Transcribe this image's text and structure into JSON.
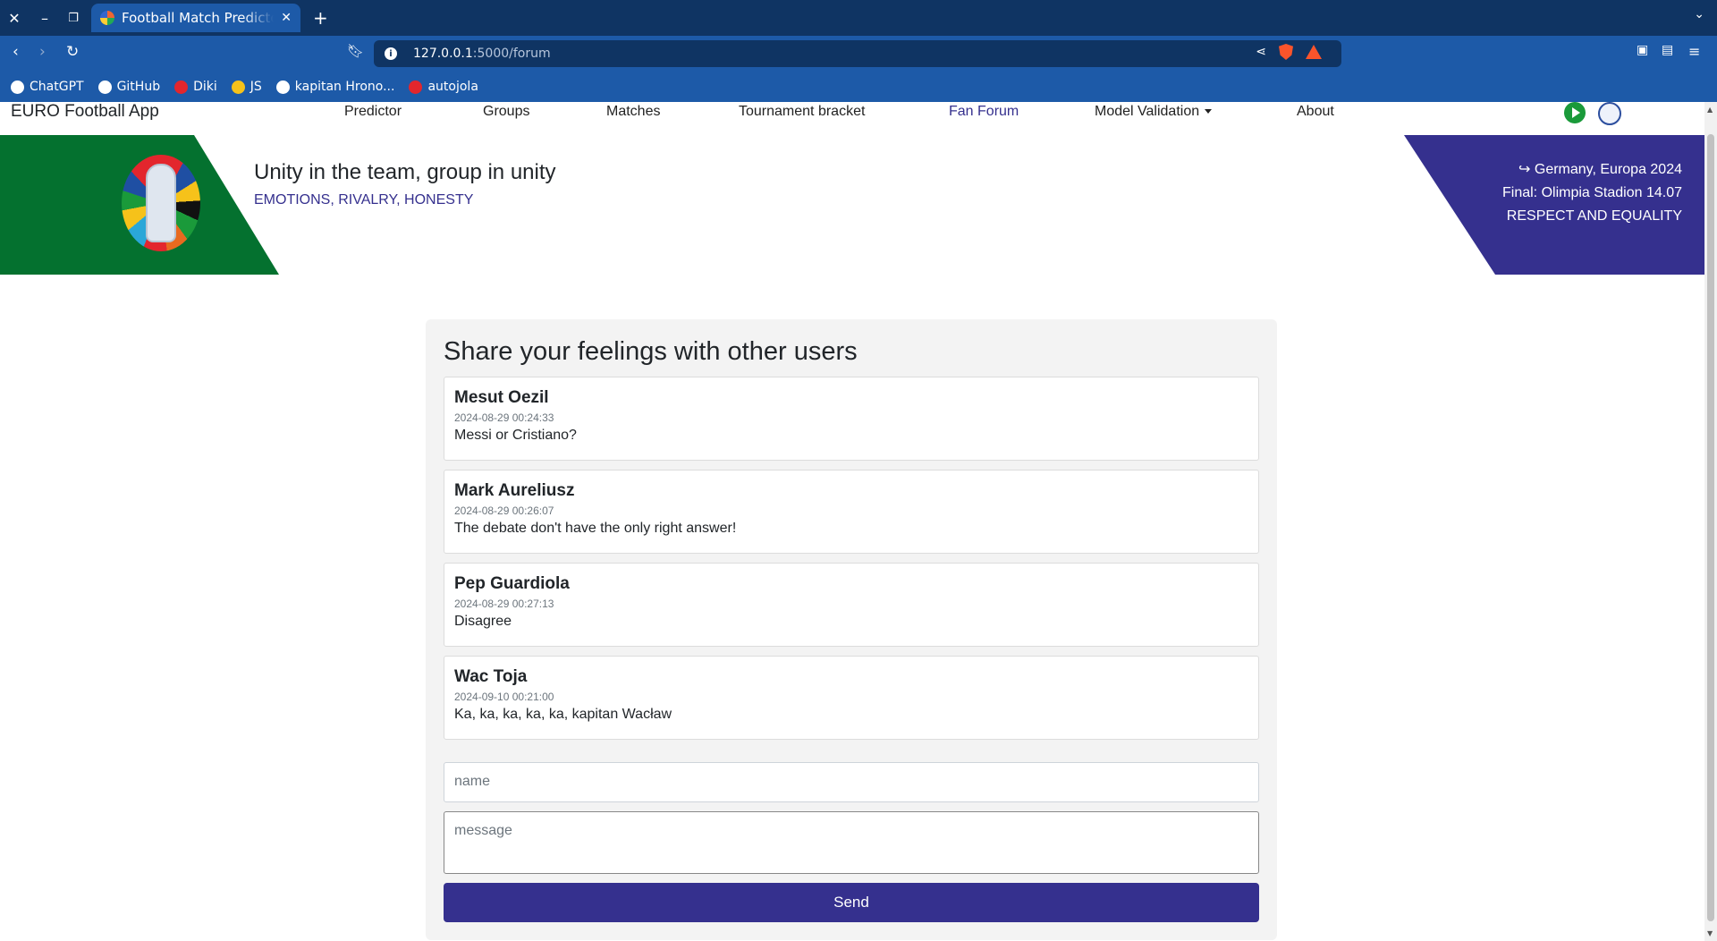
{
  "browser": {
    "tab_title": "Football Match Predictor",
    "url_host": "127.0.0.1",
    "url_path": ":5000/forum",
    "bookmarks": [
      "ChatGPT",
      "GitHub",
      "Diki",
      "JS",
      "kapitan Hrono...",
      "autojola"
    ]
  },
  "nav": {
    "brand": "EURO Football App",
    "links": [
      "Predictor",
      "Groups",
      "Matches",
      "Tournament bracket",
      "Fan Forum",
      "Model Validation",
      "About"
    ],
    "active": "Fan Forum"
  },
  "hero": {
    "title": "Unity in the team, group in unity",
    "subtitle": "EMOTIONS, RIVALRY, HONESTY",
    "right_line1": "↪ Germany, Europa 2024",
    "right_line2": "Final: Olimpia Stadion 14.07",
    "right_line3": "RESPECT AND EQUALITY"
  },
  "forum": {
    "heading": "Share your feelings with other users",
    "posts": [
      {
        "author": "Mesut Oezil",
        "date": "2024-08-29 00:24:33",
        "message": "Messi or Cristiano?"
      },
      {
        "author": "Mark Aureliusz",
        "date": "2024-08-29 00:26:07",
        "message": "The debate don't have the only right answer!"
      },
      {
        "author": "Pep Guardiola",
        "date": "2024-08-29 00:27:13",
        "message": "Disagree"
      },
      {
        "author": "Wac Toja",
        "date": "2024-09-10 00:21:00",
        "message": "Ka, ka, ka, ka, ka, kapitan Wacław"
      }
    ],
    "name_placeholder": "name",
    "message_placeholder": "message",
    "send_label": "Send"
  },
  "colors": {
    "browser_dark": "#0f3463",
    "browser_blue": "#1d5aa8",
    "green": "#04712f",
    "purple": "#35308e"
  }
}
